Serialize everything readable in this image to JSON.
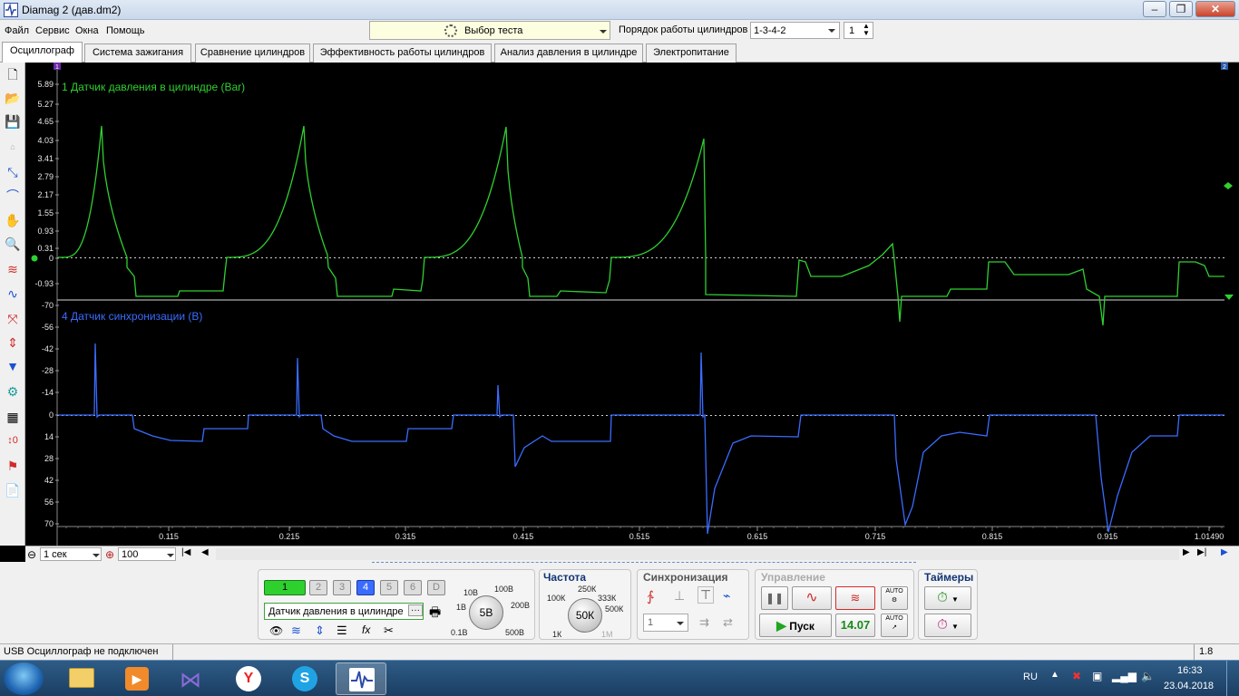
{
  "window": {
    "title": "Diamag 2 (дав.dm2)"
  },
  "menu": {
    "file": "Файл",
    "service": "Сервис",
    "windows": "Окна",
    "help": "Помощь"
  },
  "toolbar": {
    "test_select": "Выбор теста",
    "order_label": "Порядок работы цилиндров",
    "order_value": "1-3-4-2",
    "cylinder_value": "1"
  },
  "tabs": [
    {
      "label": "Осциллограф",
      "active": true
    },
    {
      "label": "Система зажигания"
    },
    {
      "label": "Сравнение цилиндров"
    },
    {
      "label": "Эффективность работы цилиндров"
    },
    {
      "label": "Анализ давления в цилиндре"
    },
    {
      "label": "Электропитание"
    }
  ],
  "scope": {
    "channel1": {
      "label": "1 Датчик давления в цилиндре (Bar)",
      "color": "#2fd02f",
      "ticks": [
        "5.89",
        "5.27",
        "4.65",
        "4.03",
        "3.41",
        "2.79",
        "2.17",
        "1.55",
        "0.93",
        "0.31",
        "0",
        "-0.93"
      ]
    },
    "channel4": {
      "label": "4 Датчик синхронизации (В)",
      "color": "#3a6cff",
      "ticks": [
        "-70",
        "-56",
        "-42",
        "-28",
        "-14",
        "0",
        "14",
        "28",
        "42",
        "56",
        "70"
      ]
    },
    "x_ticks": [
      "0.115",
      "0.215",
      "0.315",
      "0.415",
      "0.515",
      "0.615",
      "0.715",
      "0.815",
      "0.915",
      "1.01490"
    ],
    "marker_left": "1",
    "marker_right": "2"
  },
  "scrollrow": {
    "timebase": "1 сек",
    "zoom": "100"
  },
  "controls": {
    "channels": [
      "1",
      "2",
      "3",
      "4",
      "5",
      "6",
      "D"
    ],
    "channel_name": "Датчик давления в цилиндре",
    "voltage": {
      "value": "5В",
      "labels": [
        "10В",
        "100В",
        "1В",
        "200В",
        "0.1В",
        "500В"
      ]
    },
    "frequency": {
      "title": "Частота",
      "value": "50К",
      "labels": [
        "250К",
        "100К",
        "333К",
        "500К",
        "1К",
        "1М"
      ]
    },
    "sync": {
      "title": "Синхронизация",
      "channel": "1"
    },
    "control": {
      "title": "Управление",
      "start": "Пуск",
      "value": "14.07",
      "auto": "AUTO"
    },
    "timers": {
      "title": "Таймеры"
    }
  },
  "status": {
    "connection": "USB Осциллограф не подключен",
    "version": "1.8"
  },
  "taskbar": {
    "lang": "RU",
    "time": "16:33",
    "date": "23.04.2018"
  }
}
